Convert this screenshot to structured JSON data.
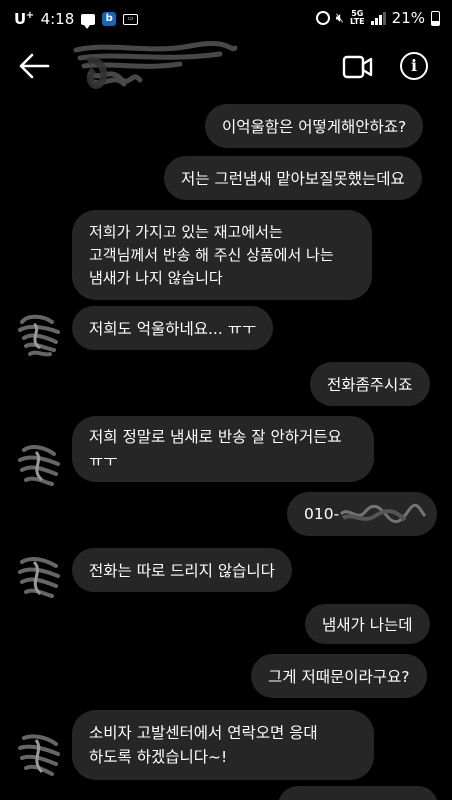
{
  "status_bar": {
    "carrier": "U",
    "carrier_sup": "+",
    "time": "4:18",
    "notification_icons": [
      "chat-bubble-icon",
      "b-app-icon",
      "badge-icon"
    ],
    "right_icons": [
      "alarm-icon",
      "mute-icon",
      "lte-icon",
      "signal-icon"
    ],
    "lte_top": "5G",
    "lte_bottom": "LTE",
    "battery": "21%"
  },
  "header": {
    "contact_name": "",
    "icons": [
      "back-arrow-icon",
      "video-camera-icon",
      "info-icon"
    ],
    "info_glyph": "i"
  },
  "messages": [
    {
      "side": "sent",
      "lines": [
        "이억울함은 어떻게해안하죠?"
      ]
    },
    {
      "side": "sent",
      "lines": [
        "저는 그런냄새 맡아보질못했는데요"
      ]
    },
    {
      "side": "received",
      "lines": [
        "저희가 가지고 있는 재고에서는",
        "고객님께서 반송 해 주신 상품에서 나는",
        "냄새가 나지 않습니다"
      ]
    },
    {
      "side": "received",
      "lines": [
        "저희도 억울하네요... ㅠㅜ"
      ]
    },
    {
      "side": "sent",
      "lines": [
        "전화좀주시죠"
      ]
    },
    {
      "side": "received",
      "lines": [
        "저희 정말로 냄새로 반송 잘 안하거든요",
        "ㅠㅜ"
      ]
    },
    {
      "side": "sent",
      "lines": [
        "010-"
      ]
    },
    {
      "side": "received",
      "lines": [
        "전화는 따로 드리지 않습니다"
      ]
    },
    {
      "side": "sent",
      "lines": [
        "냄새가 나는데"
      ]
    },
    {
      "side": "sent",
      "lines": [
        "그게 저때문이라구요?"
      ]
    },
    {
      "side": "received",
      "lines": [
        "소비자 고발센터에서 연락오면 응대",
        "하도록 하겠습니다~!"
      ]
    }
  ],
  "colors": {
    "background": "#000000",
    "bubble": "#262626",
    "text": "#ffffff",
    "b_badge": "#1565c0"
  }
}
